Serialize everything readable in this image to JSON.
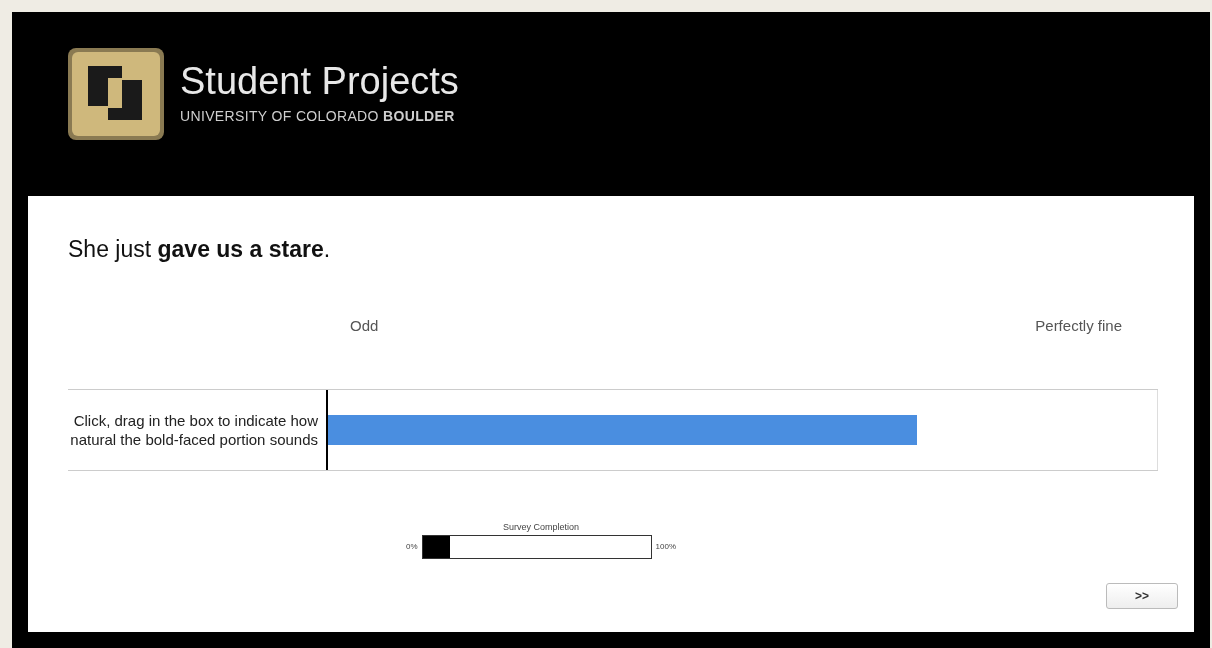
{
  "header": {
    "title": "Student Projects",
    "subtitle": "UNIVERSITY OF COLORADO **BOULDER**"
  },
  "question": {
    "text": "She just **gave us a stare**."
  },
  "scale": {
    "left_label": "Odd",
    "right_label": "Perfectly fine",
    "instruction": "Click, drag in the box to indicate how natural the bold-faced portion sounds",
    "level": 0.71
  },
  "progress": {
    "title": "Survey Completion",
    "min_label": "0%",
    "max_label": "100%",
    "level": 0.12
  },
  "next_button": ">>"
}
